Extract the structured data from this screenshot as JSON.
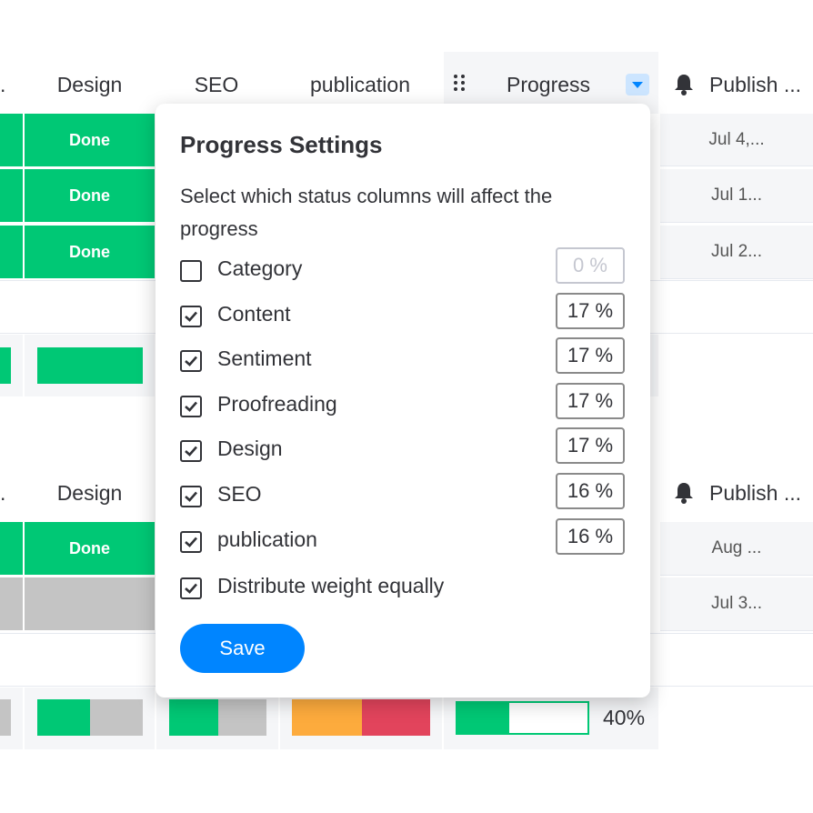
{
  "top_group": {
    "headers": {
      "truncated": ".",
      "design": "Design",
      "seo": "SEO",
      "publication": "publication",
      "progress": "Progress",
      "publish": "Publish ..."
    },
    "rows": [
      {
        "design": "Done",
        "date": "Jul 4,..."
      },
      {
        "design": "Done",
        "date": "Jul 1..."
      },
      {
        "design": "Done",
        "date": "Jul 2..."
      }
    ]
  },
  "bottom_group": {
    "headers": {
      "truncated": ".",
      "design": "Design",
      "publish": "Publish ..."
    },
    "rows": [
      {
        "design": "Done",
        "date": "Aug ..."
      },
      {
        "design": "",
        "date": "Jul 3..."
      }
    ],
    "summary": {
      "progress_value": 40,
      "progress_label": "40%"
    }
  },
  "popup": {
    "title": "Progress Settings",
    "description": "Select which status columns will affect the progress",
    "options": [
      {
        "label": "Category",
        "checked": false,
        "percent": "0 %",
        "disabled": true
      },
      {
        "label": "Content",
        "checked": true,
        "percent": "17 %"
      },
      {
        "label": "Sentiment",
        "checked": true,
        "percent": "17 %"
      },
      {
        "label": "Proofreading",
        "checked": true,
        "percent": "17 %"
      },
      {
        "label": "Design",
        "checked": true,
        "percent": "17 %"
      },
      {
        "label": "SEO",
        "checked": true,
        "percent": "16 %"
      },
      {
        "label": "publication",
        "checked": true,
        "percent": "16 %"
      }
    ],
    "distribute": {
      "label": "Distribute weight equally",
      "checked": true
    },
    "save_label": "Save"
  },
  "colors": {
    "done": "#00c875",
    "gray": "#c4c4c4",
    "orange": "#fdab3d",
    "red": "#e2445c",
    "primary": "#0085ff"
  },
  "icons": {
    "drag": "drag-handle-icon",
    "dropdown": "chevron-down-icon",
    "bell": "bell-icon",
    "check": "check-icon"
  }
}
